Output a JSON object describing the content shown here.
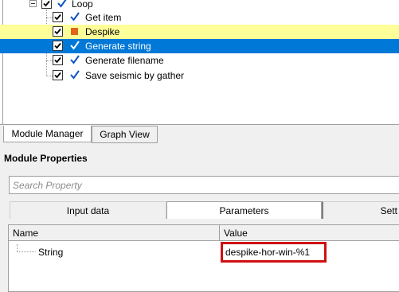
{
  "tree": {
    "items": [
      {
        "label": "Loop",
        "checked": true
      },
      {
        "label": "Get item",
        "checked": true
      },
      {
        "label": "Despike",
        "checked": true,
        "status": "orange-square-icon"
      },
      {
        "label": "Generate string",
        "checked": true
      },
      {
        "label": "Generate filename",
        "checked": true
      },
      {
        "label": "Save seismic by gather",
        "checked": true
      }
    ]
  },
  "bottom_tabs": [
    "Module Manager",
    "Graph View"
  ],
  "module_properties": {
    "title": "Module Properties",
    "search_placeholder": "Search Property",
    "tabs": [
      "Input data",
      "Parameters",
      "Sett"
    ],
    "grid": {
      "columns": [
        "Name",
        "Value"
      ],
      "rows": [
        {
          "name": "String",
          "value": "despike-hor-win-%1"
        }
      ]
    }
  },
  "colors": {
    "selection": "#0078d7",
    "highlight": "#ffff99",
    "check": "#0a55c5",
    "status_square": "#e2661a",
    "callout_border": "#d01010"
  }
}
